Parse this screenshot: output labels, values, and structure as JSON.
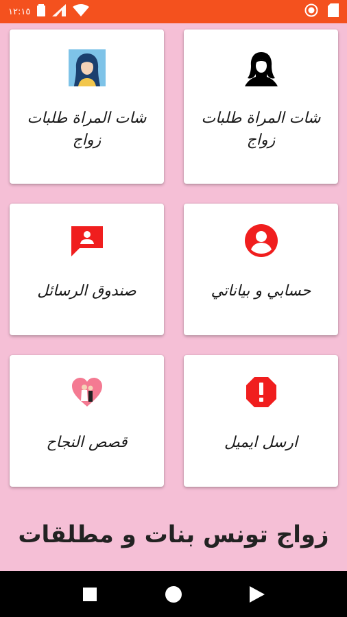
{
  "status_bar": {
    "time": "١٢:١٥",
    "icons": [
      "battery-icon",
      "signal-icon",
      "wifi-icon",
      "record-icon",
      "sim-icon"
    ]
  },
  "cards": [
    {
      "label": "شات المراة طلبات زواج",
      "icon": "woman-silhouette-icon"
    },
    {
      "label": "شات المراة طلبات زواج",
      "icon": "woman-avatar-icon"
    },
    {
      "label": "حسابي و بياناتي",
      "icon": "account-circle-icon"
    },
    {
      "label": "صندوق الرسائل",
      "icon": "message-contact-icon"
    },
    {
      "label": "ارسل ايميل",
      "icon": "alert-octagon-icon"
    },
    {
      "label": "قصص النجاح",
      "icon": "couple-heart-icon"
    }
  ],
  "footer": {
    "title": "زواج تونس بنات و مطلقات"
  },
  "nav": {
    "icons": [
      "recents-icon",
      "home-icon",
      "back-icon"
    ]
  },
  "colors": {
    "status_bar": "#f4511e",
    "background": "#f5bfd6",
    "icon_red": "#f01e1e",
    "card": "#ffffff"
  }
}
